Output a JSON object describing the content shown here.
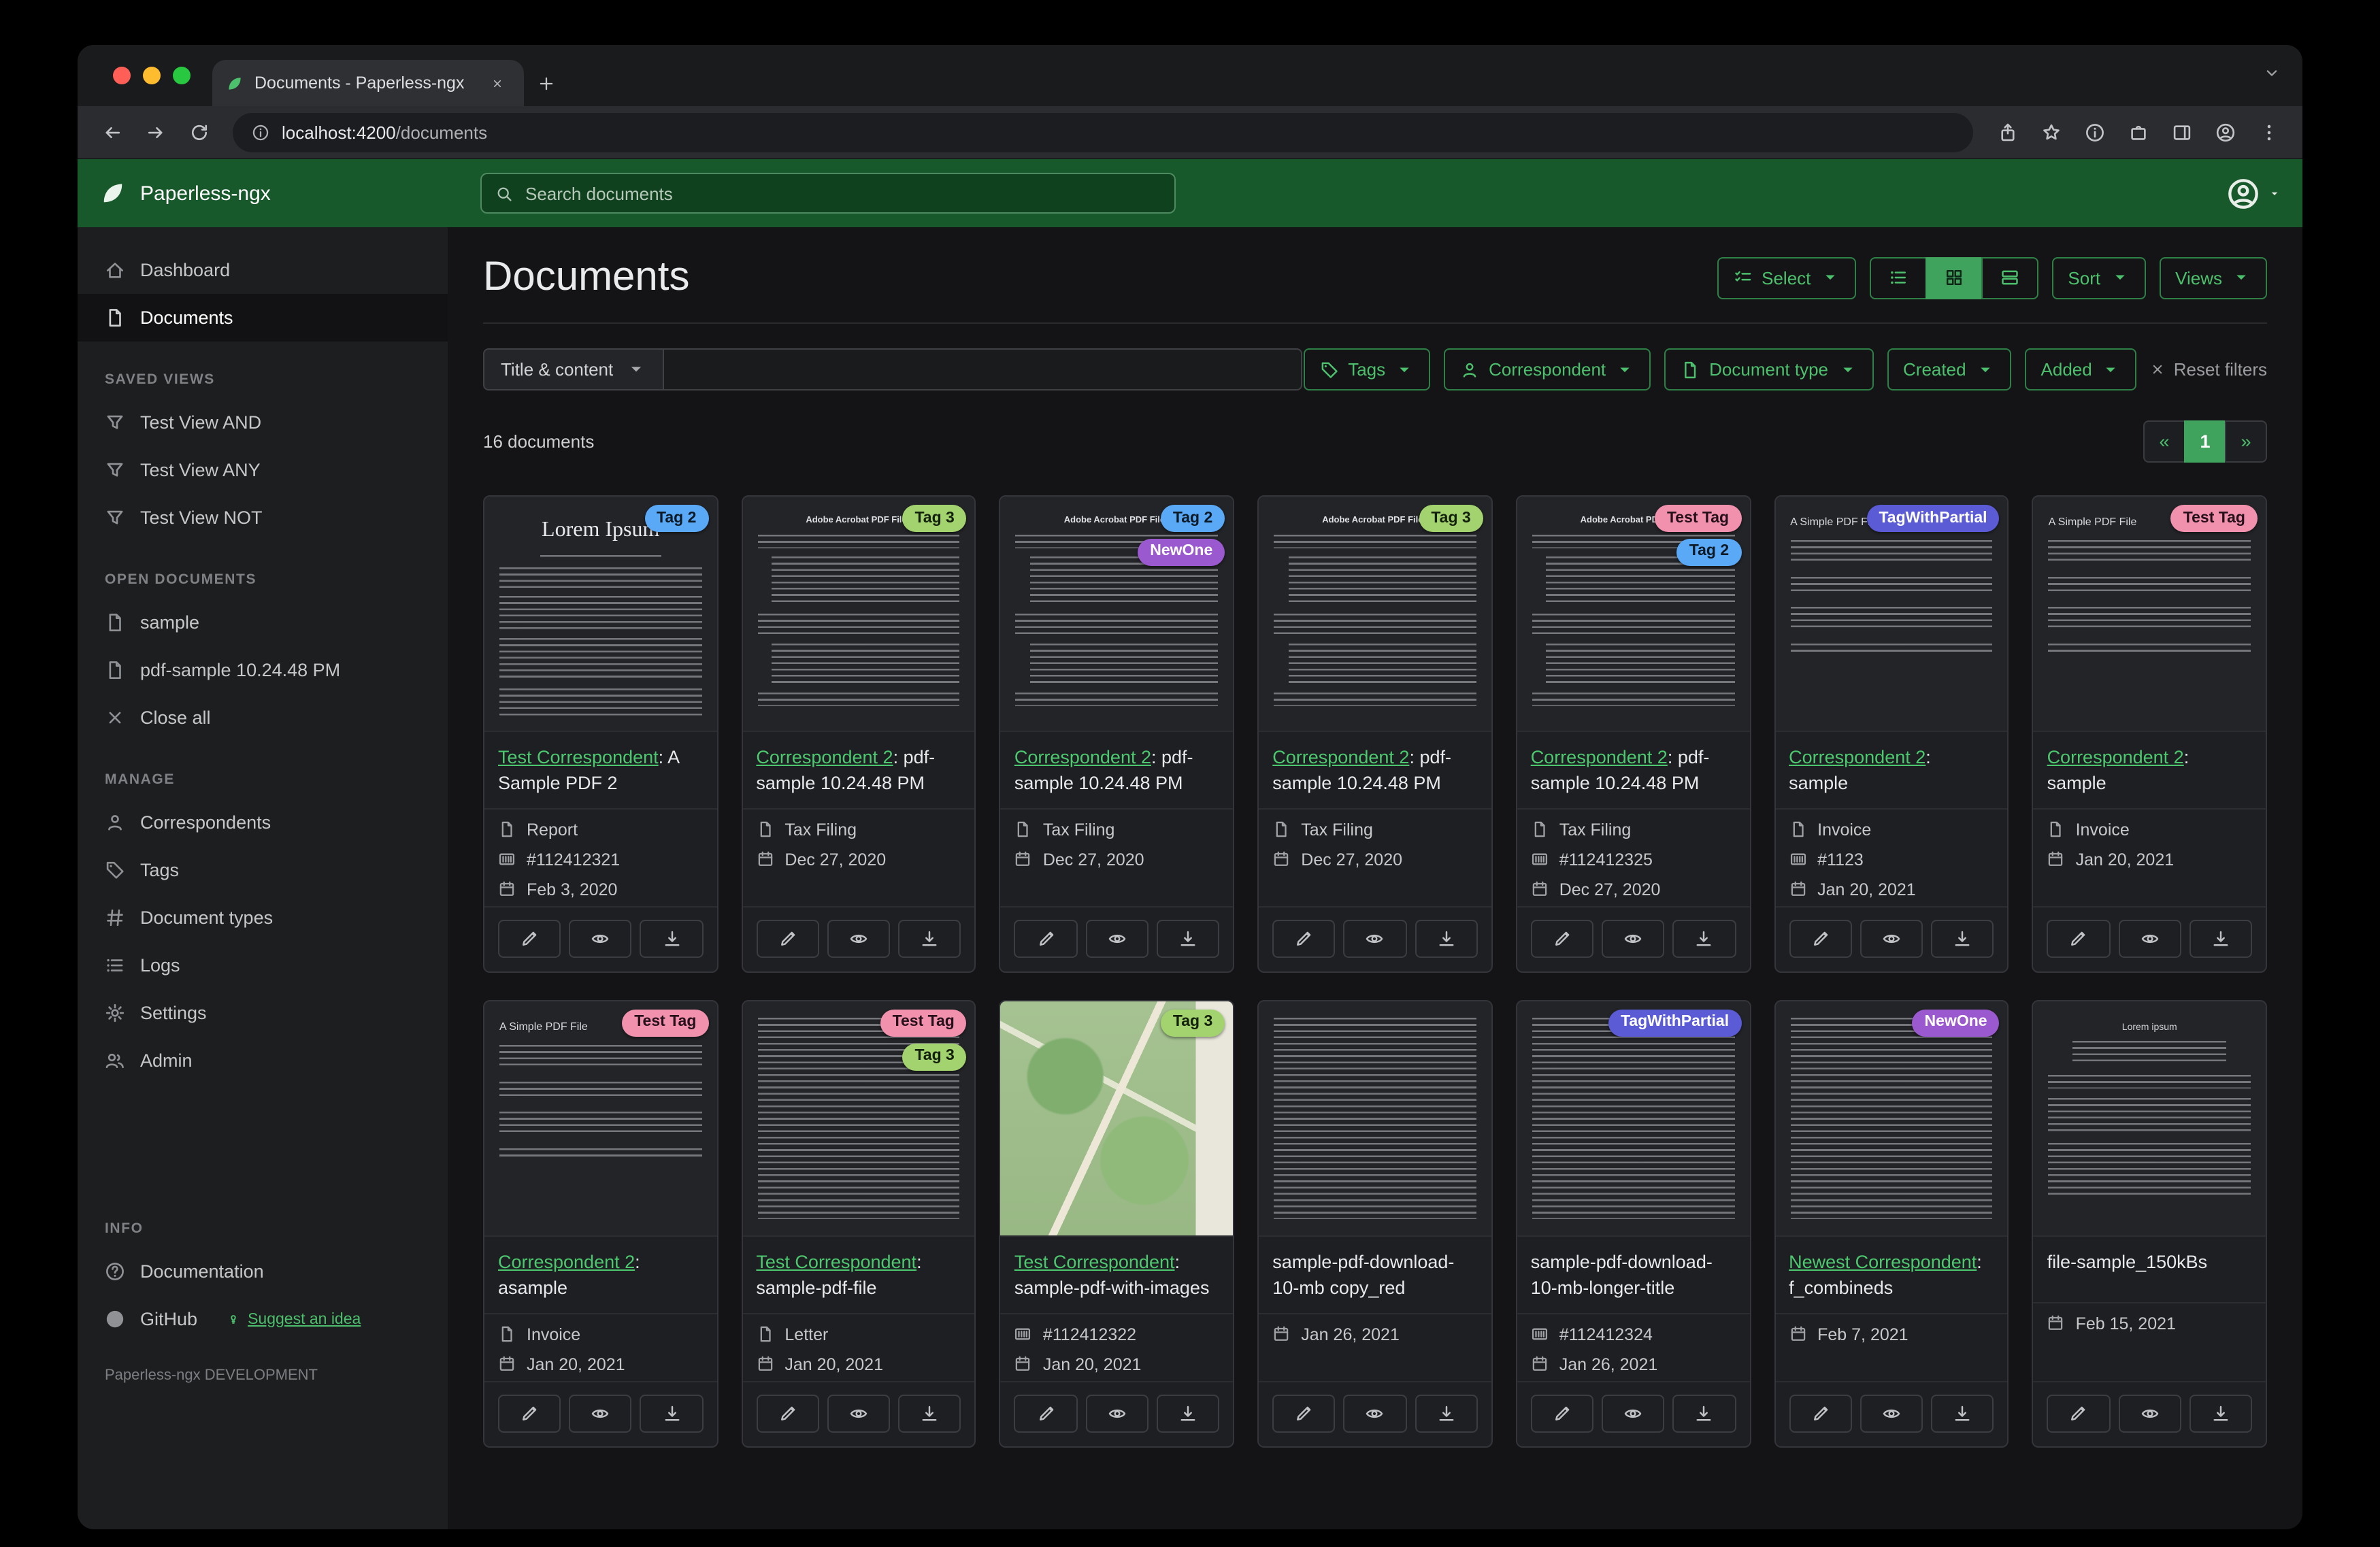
{
  "colors": {
    "brand_green": "#17592b",
    "accent_green": "#4cc06c",
    "accent_border": "#2e8047",
    "active_green": "#3fa35d"
  },
  "browser": {
    "tab_title": "Documents - Paperless-ngx",
    "url_host": "localhost:4200",
    "url_path": "/documents"
  },
  "header": {
    "brand": "Paperless-ngx",
    "search_placeholder": "Search documents"
  },
  "sidebar": {
    "primary": [
      {
        "label": "Dashboard",
        "icon": "house"
      },
      {
        "label": "Documents",
        "icon": "file",
        "active": true
      }
    ],
    "sections": [
      {
        "heading": "SAVED VIEWS",
        "items": [
          {
            "label": "Test View AND",
            "icon": "funnel"
          },
          {
            "label": "Test View ANY",
            "icon": "funnel"
          },
          {
            "label": "Test View NOT",
            "icon": "funnel"
          }
        ]
      },
      {
        "heading": "OPEN DOCUMENTS",
        "items": [
          {
            "label": "sample",
            "icon": "file"
          },
          {
            "label": "pdf-sample 10.24.48 PM",
            "icon": "file"
          },
          {
            "label": "Close all",
            "icon": "xmark"
          }
        ]
      },
      {
        "heading": "MANAGE",
        "items": [
          {
            "label": "Correspondents",
            "icon": "person"
          },
          {
            "label": "Tags",
            "icon": "tag"
          },
          {
            "label": "Document types",
            "icon": "hash"
          },
          {
            "label": "Logs",
            "icon": "lines"
          },
          {
            "label": "Settings",
            "icon": "gear"
          },
          {
            "label": "Admin",
            "icon": "people"
          }
        ]
      },
      {
        "heading": "INFO",
        "gap_before": true,
        "items": [
          {
            "label": "Documentation",
            "icon": "question"
          },
          {
            "label": "GitHub",
            "icon": "github",
            "extra": "Suggest an idea"
          }
        ]
      }
    ],
    "footer": "Paperless-ngx DEVELOPMENT"
  },
  "toolbar": {
    "title": "Documents",
    "select_label": "Select",
    "sort_label": "Sort",
    "views_label": "Views"
  },
  "filters": {
    "title_dropdown": "Title & content",
    "buttons": [
      {
        "label": "Tags",
        "icon": "tag"
      },
      {
        "label": "Correspondent",
        "icon": "person"
      },
      {
        "label": "Document type",
        "icon": "file"
      },
      {
        "label": "Created",
        "icon": null
      },
      {
        "label": "Added",
        "icon": null
      }
    ],
    "reset": "Reset filters"
  },
  "results": {
    "count_text": "16 documents",
    "prev": "«",
    "page": "1",
    "next": "»"
  },
  "tag_colors": {
    "Tag 2": {
      "bg": "#5aa9f7",
      "fg": "#0d1a26"
    },
    "Tag 3": {
      "bg": "#a3d36e",
      "fg": "#13200c"
    },
    "NewOne": {
      "bg": "#9b59d0",
      "fg": "#ffffff"
    },
    "Test Tag": {
      "bg": "#f191ae",
      "fg": "#26101a"
    },
    "TagWithPartial": {
      "bg": "#5b5bd6",
      "fg": "#ffffff"
    }
  },
  "card_actions": [
    {
      "name": "edit",
      "icon": "pencil"
    },
    {
      "name": "view",
      "icon": "eye"
    },
    {
      "name": "download",
      "icon": "download"
    }
  ],
  "documents": [
    {
      "tags": [
        "Tag 2"
      ],
      "correspondent": "Test Correspondent",
      "title": "A Sample PDF 2",
      "doc_type": "Report",
      "asn": "#112412321",
      "date": "Feb 3, 2020",
      "thumb": {
        "kind": "lorem-serif",
        "heading": "Lorem Ipsum"
      }
    },
    {
      "tags": [
        "Tag 3"
      ],
      "correspondent": "Correspondent 2",
      "title": "pdf-sample 10.24.48 PM",
      "doc_type": "Tax Filing",
      "asn": null,
      "date": "Dec 27, 2020",
      "thumb": {
        "kind": "acrobat",
        "heading": "Adobe Acrobat PDF Files"
      }
    },
    {
      "tags": [
        "Tag 2",
        "NewOne"
      ],
      "correspondent": "Correspondent 2",
      "title": "pdf-sample 10.24.48 PM",
      "doc_type": "Tax Filing",
      "asn": null,
      "date": "Dec 27, 2020",
      "thumb": {
        "kind": "acrobat",
        "heading": "Adobe Acrobat PDF Files"
      }
    },
    {
      "tags": [
        "Tag 3"
      ],
      "correspondent": "Correspondent 2",
      "title": "pdf-sample 10.24.48 PM",
      "doc_type": "Tax Filing",
      "asn": null,
      "date": "Dec 27, 2020",
      "thumb": {
        "kind": "acrobat",
        "heading": "Adobe Acrobat PDF Files"
      }
    },
    {
      "tags": [
        "Test Tag",
        "Tag 2"
      ],
      "correspondent": "Correspondent 2",
      "title": "pdf-sample 10.24.48 PM",
      "doc_type": "Tax Filing",
      "asn": "#112412325",
      "date": "Dec 27, 2020",
      "thumb": {
        "kind": "acrobat",
        "heading": "Adobe Acrobat PDF Files"
      }
    },
    {
      "tags": [
        "TagWithPartial"
      ],
      "correspondent": "Correspondent 2",
      "title": "sample",
      "doc_type": "Invoice",
      "asn": "#1123",
      "date": "Jan 20, 2021",
      "thumb": {
        "kind": "simple",
        "heading": "A Simple PDF File"
      }
    },
    {
      "tags": [
        "Test Tag"
      ],
      "correspondent": "Correspondent 2",
      "title": "sample",
      "doc_type": "Invoice",
      "asn": null,
      "date": "Jan 20, 2021",
      "thumb": {
        "kind": "simple",
        "heading": "A Simple PDF File"
      }
    },
    {
      "tags": [
        "Test Tag"
      ],
      "correspondent": "Correspondent 2",
      "title": "asample",
      "doc_type": "Invoice",
      "asn": null,
      "date": "Jan 20, 2021",
      "thumb": {
        "kind": "simple",
        "heading": "A Simple PDF File"
      }
    },
    {
      "tags": [
        "Test Tag",
        "Tag 3"
      ],
      "correspondent": "Test Correspondent",
      "title": "sample-pdf-file",
      "doc_type": "Letter",
      "asn": null,
      "date": "Jan 20, 2021",
      "thumb": {
        "kind": "dense",
        "heading": ""
      }
    },
    {
      "tags": [
        "Tag 3"
      ],
      "correspondent": "Test Correspondent",
      "title": "sample-pdf-with-images",
      "doc_type": null,
      "asn": "#112412322",
      "date": "Jan 20, 2021",
      "thumb": {
        "kind": "map",
        "heading": ""
      }
    },
    {
      "tags": [],
      "correspondent": null,
      "title": "sample-pdf-download-10-mb copy_red",
      "doc_type": null,
      "asn": null,
      "date": "Jan 26, 2021",
      "thumb": {
        "kind": "dense",
        "heading": ""
      }
    },
    {
      "tags": [
        "TagWithPartial"
      ],
      "correspondent": null,
      "title": "sample-pdf-download-10-mb-longer-title",
      "doc_type": null,
      "asn": "#112412324",
      "date": "Jan 26, 2021",
      "thumb": {
        "kind": "dense",
        "heading": ""
      }
    },
    {
      "tags": [
        "NewOne"
      ],
      "correspondent": "Newest Correspondent",
      "title": "f_combineds",
      "doc_type": null,
      "asn": null,
      "date": "Feb 7, 2021",
      "thumb": {
        "kind": "dense",
        "heading": ""
      }
    },
    {
      "tags": [],
      "correspondent": null,
      "title": "file-sample_150kBs",
      "doc_type": null,
      "asn": null,
      "date": "Feb 15, 2021",
      "thumb": {
        "kind": "lorem-center",
        "heading": "Lorem ipsum"
      }
    }
  ]
}
